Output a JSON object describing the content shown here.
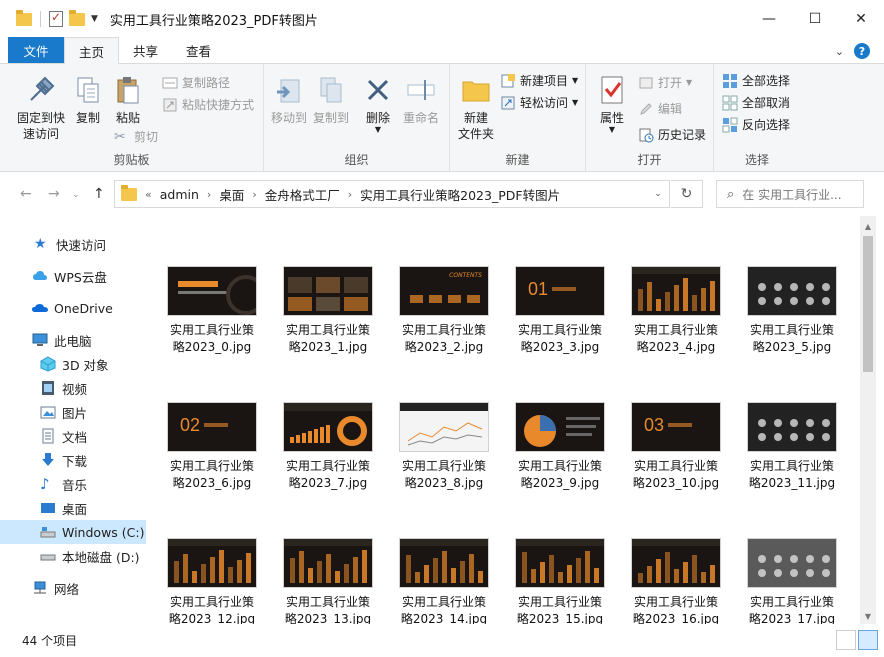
{
  "window": {
    "title": "实用工具行业策略2023_PDF转图片",
    "controls": {
      "minimize": "—",
      "maximize": "☐",
      "close": "✕"
    }
  },
  "ribbon_tabs": {
    "file": "文件",
    "home": "主页",
    "share": "共享",
    "view": "查看"
  },
  "clipboard": {
    "pin": "固定到快\n速访问",
    "copy": "复制",
    "paste": "粘贴",
    "copy_path": "复制路径",
    "paste_shortcut": "粘贴快捷方式",
    "cut": "剪切",
    "label": "剪贴板"
  },
  "organize": {
    "move_to": "移动到",
    "copy_to": "复制到",
    "delete": "删除",
    "rename": "重命名",
    "label": "组织"
  },
  "new": {
    "new_item": "新建项目",
    "easy_access": "轻松访问",
    "new_folder": "新建\n文件夹",
    "label": "新建"
  },
  "open": {
    "properties": "属性",
    "open": "打开",
    "edit": "编辑",
    "history": "历史记录",
    "label": "打开"
  },
  "select": {
    "select_all": "全部选择",
    "select_none": "全部取消",
    "invert": "反向选择",
    "label": "选择"
  },
  "address": {
    "prefix": "«",
    "crumbs": [
      "admin",
      "桌面",
      "金舟格式工厂",
      "实用工具行业策略2023_PDF转图片"
    ]
  },
  "search": {
    "placeholder": "在 实用工具行业..."
  },
  "sidebar": {
    "items": [
      {
        "label": "快速访问",
        "icon": "star-icon"
      },
      {
        "label": "WPS云盘",
        "icon": "cloud-icon"
      },
      {
        "label": "OneDrive",
        "icon": "onedrive-icon"
      },
      {
        "label": "此电脑",
        "icon": "computer-icon"
      },
      {
        "label": "3D 对象",
        "icon": "cube-icon"
      },
      {
        "label": "视频",
        "icon": "video-icon"
      },
      {
        "label": "图片",
        "icon": "picture-icon"
      },
      {
        "label": "文档",
        "icon": "document-icon"
      },
      {
        "label": "下载",
        "icon": "download-icon"
      },
      {
        "label": "音乐",
        "icon": "music-icon"
      },
      {
        "label": "桌面",
        "icon": "desktop-icon"
      },
      {
        "label": "Windows (C:)",
        "icon": "drive-c-icon"
      },
      {
        "label": "本地磁盘 (D:)",
        "icon": "drive-d-icon"
      },
      {
        "label": "网络",
        "icon": "network-icon"
      }
    ]
  },
  "files": [
    {
      "line1": "实用工具行业策",
      "line2": "略2023_0.jpg"
    },
    {
      "line1": "实用工具行业策",
      "line2": "略2023_1.jpg"
    },
    {
      "line1": "实用工具行业策",
      "line2": "略2023_2.jpg"
    },
    {
      "line1": "实用工具行业策",
      "line2": "略2023_3.jpg"
    },
    {
      "line1": "实用工具行业策",
      "line2": "略2023_4.jpg"
    },
    {
      "line1": "实用工具行业策",
      "line2": "略2023_5.jpg"
    },
    {
      "line1": "实用工具行业策",
      "line2": "略2023_6.jpg"
    },
    {
      "line1": "实用工具行业策",
      "line2": "略2023_7.jpg"
    },
    {
      "line1": "实用工具行业策",
      "line2": "略2023_8.jpg"
    },
    {
      "line1": "实用工具行业策",
      "line2": "略2023_9.jpg"
    },
    {
      "line1": "实用工具行业策",
      "line2": "略2023_10.jpg"
    },
    {
      "line1": "实用工具行业策",
      "line2": "略2023_11.jpg"
    },
    {
      "line1": "实用工具行业策",
      "line2": "略2023_12.jpg"
    },
    {
      "line1": "实用工具行业策",
      "line2": "略2023_13.jpg"
    },
    {
      "line1": "实用工具行业策",
      "line2": "略2023_14.jpg"
    },
    {
      "line1": "实用工具行业策",
      "line2": "略2023_15.jpg"
    },
    {
      "line1": "实用工具行业策",
      "line2": "略2023_16.jpg"
    },
    {
      "line1": "实用工具行业策",
      "line2": "略2023_17.jpg"
    }
  ],
  "thumb_text": {
    "t2": "CONTENTS",
    "t3": "01",
    "t6": "02",
    "t10": "03"
  },
  "status": {
    "count": "44 个项目"
  },
  "colors": {
    "accent": "#1979ca",
    "selected": "#cce8ff",
    "thumb_bg": "#1a1512",
    "thumb_orange": "#e8892b"
  }
}
